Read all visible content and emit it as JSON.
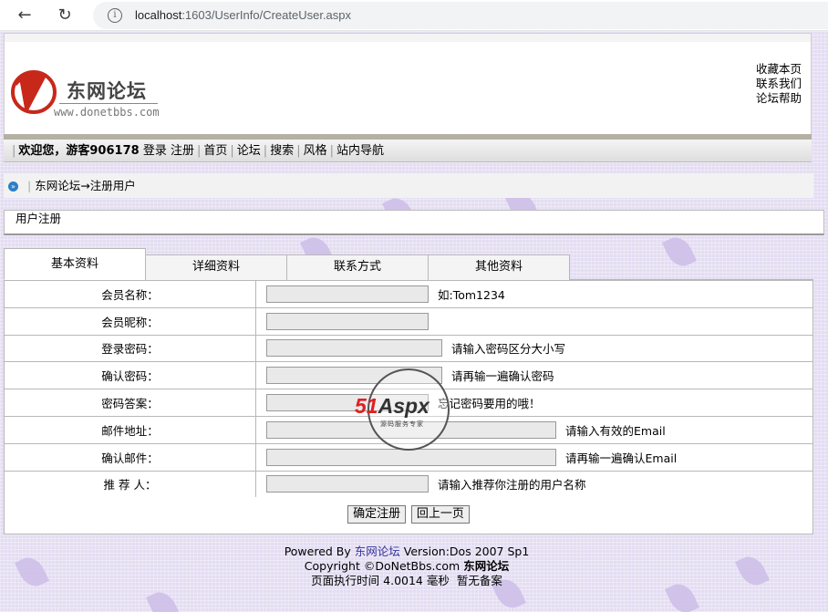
{
  "browser": {
    "url_host": "localhost",
    "url_path": ":1603/UserInfo/CreateUser.aspx"
  },
  "header": {
    "logo_cn": "东网论坛",
    "logo_url": "www.donetbbs.com",
    "links": [
      "收藏本页",
      "联系我们",
      "论坛帮助"
    ]
  },
  "menubar": {
    "welcome": "欢迎您，游客906178",
    "items": [
      "登录",
      "注册",
      "首页",
      "论坛",
      "搜索",
      "风格",
      "站内导航"
    ]
  },
  "breadcrumb": {
    "forum": "东网论坛",
    "current": "→注册用户"
  },
  "section_title": "用户注册",
  "tabs": [
    "基本资料",
    "详细资料",
    "联系方式",
    "其他资料"
  ],
  "form": {
    "rows": [
      {
        "label": "会员名称：",
        "hint": "如:Tom1234"
      },
      {
        "label": "会员昵称：",
        "hint": ""
      },
      {
        "label": "登录密码：",
        "hint": "请输入密码区分大小写"
      },
      {
        "label": "确认密码：",
        "hint": "请再输一遍确认密码"
      },
      {
        "label": "密码答案：",
        "hint": "忘记密码要用的哦！"
      },
      {
        "label": "邮件地址：",
        "hint": "请输入有效的Email"
      },
      {
        "label": "确认邮件：",
        "hint": "请再输一遍确认Email"
      },
      {
        "label": "推 荐 人：",
        "hint": "请输入推荐你注册的用户名称"
      }
    ],
    "submit": "确定注册",
    "back": "回上一页"
  },
  "footer": {
    "powered_prefix": "Powered By ",
    "powered_brand": "东网论坛",
    "powered_version": " Version:Dos 2007 Sp1",
    "copyright": "Copyright ©DoNetBbs.com ",
    "copyright_brand": "东网论坛",
    "exec_time": "页面执行时间 4.0014 毫秒",
    "record": "暂无备案"
  },
  "watermark": {
    "num": "51",
    "rest": "Aspx",
    "sub": "源码服务专家"
  }
}
